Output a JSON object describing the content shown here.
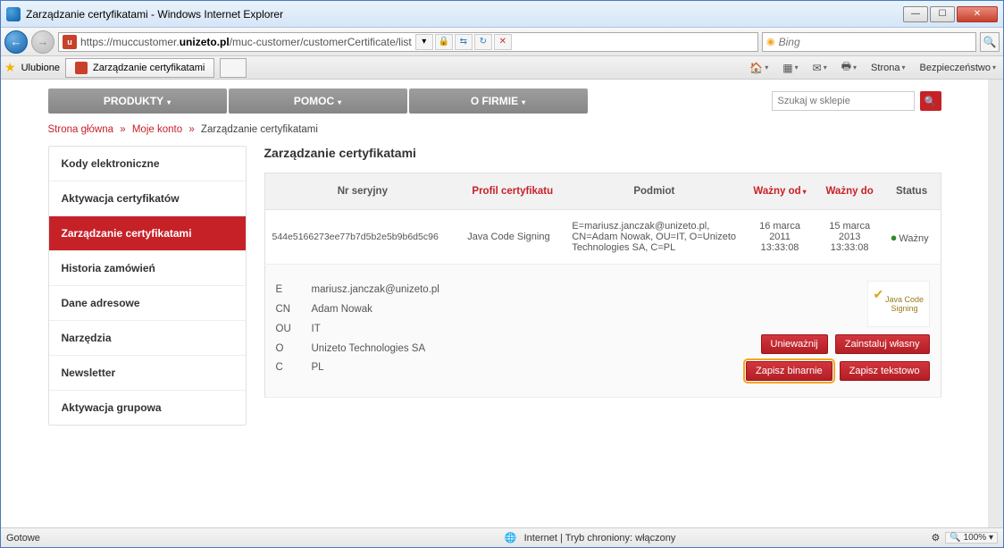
{
  "window": {
    "title": "Zarządzanie certyfikatami - Windows Internet Explorer"
  },
  "nav": {
    "url_prefix": "https://muccustomer.",
    "url_host": "unizeto.pl",
    "url_path": "/muc-customer/customerCertificate/list",
    "search_placeholder": "Bing"
  },
  "tabbar": {
    "favorites_label": "Ulubione",
    "tab_label": "Zarządzanie certyfikatami",
    "strona_label": "Strona",
    "bezp_label": "Bezpieczeństwo"
  },
  "topnav": {
    "items": [
      "PRODUKTY",
      "POMOC",
      "O FIRMIE"
    ],
    "search_placeholder": "Szukaj w sklepie"
  },
  "breadcrumb": {
    "home": "Strona główna",
    "account": "Moje konto",
    "current": "Zarządzanie certyfikatami"
  },
  "sidebar": {
    "items": [
      {
        "label": "Kody elektroniczne"
      },
      {
        "label": "Aktywacja certyfikatów"
      },
      {
        "label": "Zarządzanie certyfikatami"
      },
      {
        "label": "Historia zamówień"
      },
      {
        "label": "Dane adresowe"
      },
      {
        "label": "Narzędzia"
      },
      {
        "label": "Newsletter"
      },
      {
        "label": "Aktywacja grupowa"
      }
    ],
    "active_index": 2
  },
  "content": {
    "heading": "Zarządzanie certyfikatami",
    "columns": {
      "serial": "Nr seryjny",
      "profile": "Profil certyfikatu",
      "subject": "Podmiot",
      "valid_from": "Ważny od",
      "valid_to": "Ważny do",
      "status": "Status"
    },
    "row": {
      "serial": "544e5166273ee77b7d5b2e5b9b6d5c96",
      "profile": "Java Code Signing",
      "subject": "E=mariusz.janczak@unizeto.pl, CN=Adam Nowak, OU=IT, O=Unizeto Technologies SA, C=PL",
      "valid_from_line1": "16 marca",
      "valid_from_line2": "2011",
      "valid_from_line3": "13:33:08",
      "valid_to_line1": "15 marca",
      "valid_to_line2": "2013",
      "valid_to_line3": "13:33:08",
      "status": "Ważny"
    },
    "detail": {
      "E": "mariusz.janczak@unizeto.pl",
      "CN": "Adam Nowak",
      "OU": "IT",
      "O": "Unizeto Technologies SA",
      "C": "PL",
      "icon_text": "Java Code Signing"
    },
    "buttons": {
      "invalidate": "Unieważnij",
      "install_own": "Zainstaluj własny",
      "save_binary": "Zapisz binarnie",
      "save_text": "Zapisz tekstowo"
    }
  },
  "statusbar": {
    "ready": "Gotowe",
    "zone": "Internet | Tryb chroniony: włączony",
    "zoom": "100%"
  }
}
